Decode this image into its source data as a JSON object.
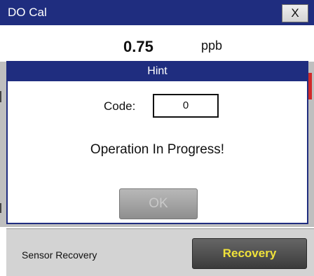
{
  "window": {
    "title": "DO Cal",
    "close_label": "X"
  },
  "reading": {
    "value": "0.75",
    "unit": "ppb"
  },
  "dialog": {
    "title": "Hint",
    "code_label": "Code:",
    "code_value": "0",
    "message": "Operation In Progress!",
    "ok_label": "OK"
  },
  "footer": {
    "label": "Sensor Recovery",
    "button_label": "Recovery"
  },
  "colors": {
    "title_bar": "#1f2d7f",
    "accent_text": "#f0e23a",
    "disabled_button": "#9f9f9f",
    "alert_marker": "#d12a2a"
  }
}
